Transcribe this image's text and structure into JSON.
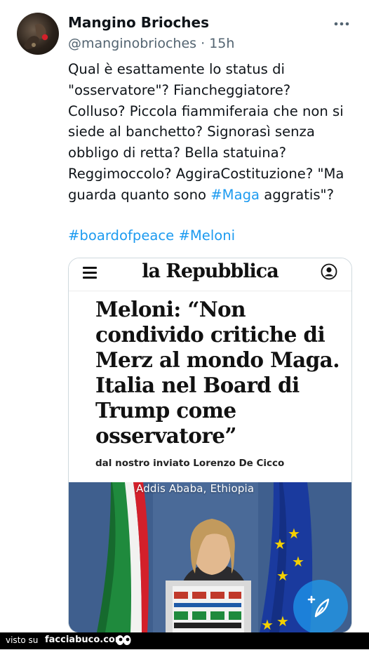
{
  "author": {
    "name": "Mangino Brioches",
    "handle": "@manginobrioches",
    "separator": "·",
    "time": "15h"
  },
  "icons": {
    "more": "more-dots-icon",
    "menu": "hamburger-menu-icon",
    "account": "user-icon",
    "compose": "compose-icon",
    "eyes": "eyes-icon"
  },
  "tweet": {
    "lines": [
      "Qual è esattamente lo status di",
      "\"osservatore\"? Fiancheggiatore?",
      "Colluso? Piccola fiammiferaia che non si",
      "siede al banchetto? Signorasì senza",
      "obbligo di retta? Bella statuina?",
      "Reggimoccolo? AggiraCostituzione? \"Ma"
    ],
    "last_line_before": "guarda quanto sono ",
    "last_line_hashtag": "#Maga",
    "last_line_after": " aggratis\"?",
    "hashtag_1": "#boardofpeace",
    "hashtag_2": "#Meloni"
  },
  "card": {
    "masthead": "la Repubblica",
    "headline_lines": [
      "Meloni: “Non",
      "condivido critiche di",
      "Merz al mondo Maga.",
      "Italia nel Board di",
      "Trump come",
      "osservatore”"
    ],
    "byline": "dal nostro inviato Lorenzo De Cicco",
    "photo_caption": "Addis Ababa, Ethiopia"
  },
  "footer": {
    "visto_label": "visto su",
    "site_label": "facciabuco.com"
  },
  "colors": {
    "link": "#1d9bf0",
    "secondary": "#536471",
    "text": "#0f1419",
    "flag_green": "#1f8a3d",
    "flag_red": "#d3202a",
    "eu_blue": "#1a3a9e",
    "eu_star": "#f4d000"
  }
}
